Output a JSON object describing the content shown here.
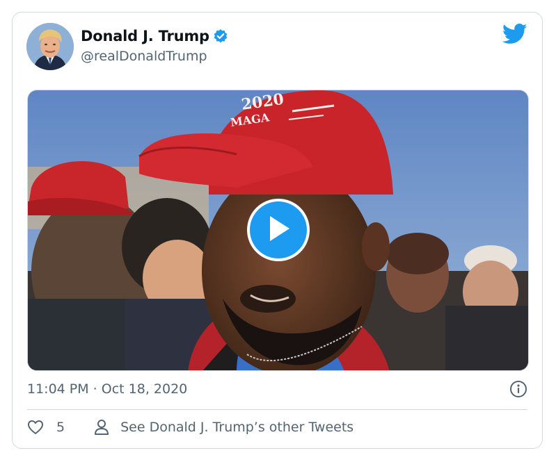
{
  "author": {
    "name": "Donald J. Trump",
    "handle": "@realDonaldTrump",
    "verified": true
  },
  "media": {
    "type": "video",
    "cap_text_top": "2020",
    "cap_text_bottom": "MAGA"
  },
  "timestamp": "11:04 PM · Oct 18, 2020",
  "actions": {
    "like_count": "5",
    "other_tweets_label": "See Donald J. Trump’s other Tweets"
  },
  "colors": {
    "accent": "#1d9bf0",
    "text": "#0f1419",
    "muted": "#536471",
    "border": "#cfd9de"
  },
  "icons": [
    "avatar",
    "verified-badge-icon",
    "twitter-bird-icon",
    "play-icon",
    "info-icon",
    "heart-icon",
    "person-icon"
  ]
}
